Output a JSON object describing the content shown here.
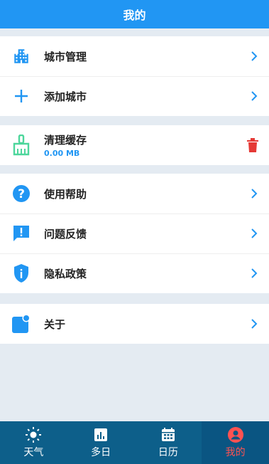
{
  "header": {
    "title": "我的"
  },
  "groups": {
    "cities": [
      {
        "label": "城市管理",
        "icon": "city-building-icon"
      },
      {
        "label": "添加城市",
        "icon": "plus-icon"
      }
    ],
    "cache": {
      "label": "清理缓存",
      "size": "0.00 MB",
      "icon": "broom-icon",
      "action_icon": "trash-icon"
    },
    "info": [
      {
        "label": "使用帮助",
        "icon": "help-icon"
      },
      {
        "label": "问题反馈",
        "icon": "feedback-icon"
      },
      {
        "label": "隐私政策",
        "icon": "privacy-shield-icon"
      }
    ],
    "about": {
      "label": "关于",
      "icon": "about-icon"
    }
  },
  "tabs": [
    {
      "label": "天气",
      "icon": "sun-icon",
      "active": false
    },
    {
      "label": "多日",
      "icon": "chart-icon",
      "active": false
    },
    {
      "label": "日历",
      "icon": "calendar-icon",
      "active": false
    },
    {
      "label": "我的",
      "icon": "user-icon",
      "active": true
    }
  ],
  "colors": {
    "accent": "#2196f3",
    "tabbar": "#0d5f8a",
    "active": "#ff5252",
    "danger": "#e53935",
    "broom": "#4cd69b"
  }
}
